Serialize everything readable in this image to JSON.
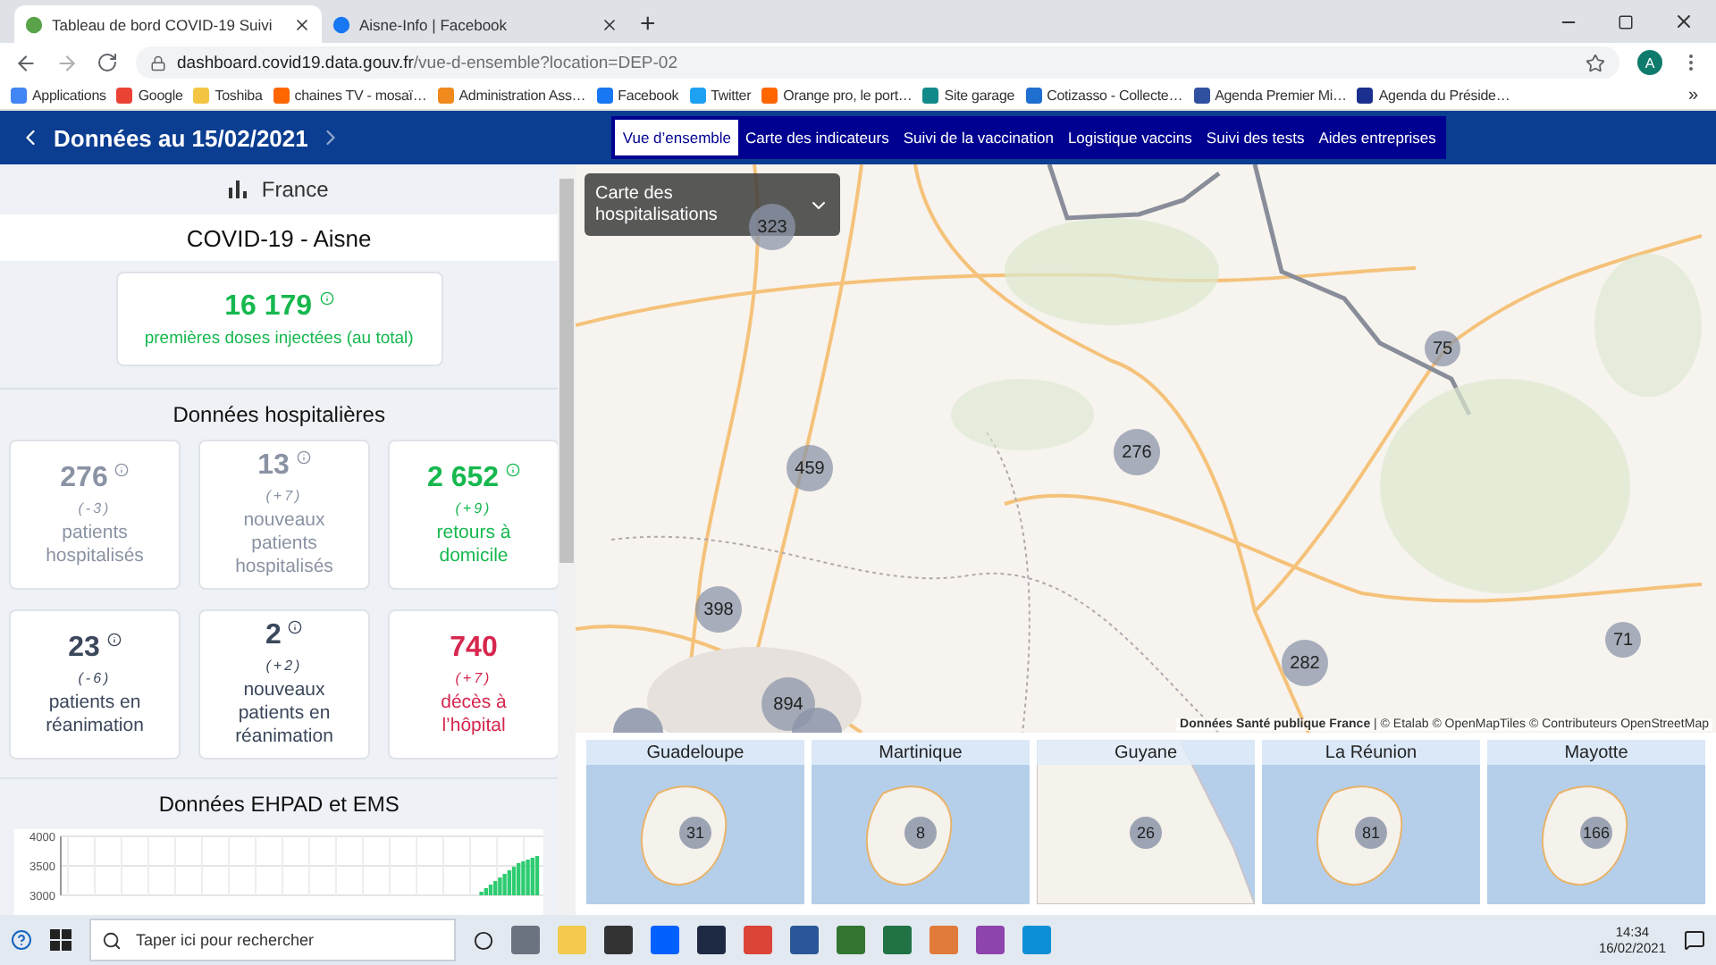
{
  "browser": {
    "tabs": [
      {
        "title": "Tableau de bord COVID-19 Suivi",
        "selected": true
      },
      {
        "title": "Aisne-Info | Facebook",
        "selected": false
      }
    ],
    "new_tab": "+",
    "url": {
      "host": "dashboard.covid19.data.gouv.fr",
      "path": "/vue-d-ensemble?location=DEP-02"
    },
    "profile": "A",
    "bookmarks": [
      {
        "label": "Applications",
        "color": "#4285f4"
      },
      {
        "label": "Google",
        "color": "#ea4335"
      },
      {
        "label": "Toshiba",
        "color": "#f4c542"
      },
      {
        "label": "chaines TV - mosaï…",
        "color": "#ff6600"
      },
      {
        "label": "Administration Ass…",
        "color": "#f08a1c"
      },
      {
        "label": "Facebook",
        "color": "#1877f2"
      },
      {
        "label": "Twitter",
        "color": "#1da1f2"
      },
      {
        "label": "Orange pro, le port…",
        "color": "#ff6600"
      },
      {
        "label": "Site garage",
        "color": "#138a8a"
      },
      {
        "label": "Cotizasso - Collecte…",
        "color": "#1f6fd0"
      },
      {
        "label": "Agenda Premier Mi…",
        "color": "#3050a0"
      },
      {
        "label": "Agenda du Préside…",
        "color": "#1b2f8f"
      }
    ],
    "bookmarks_more": "»"
  },
  "header": {
    "title": "Données au 15/02/2021",
    "nav": [
      {
        "label": "Vue d’ensemble",
        "selected": true
      },
      {
        "label": "Carte des indicateurs",
        "selected": false
      },
      {
        "label": "Suivi de la vaccination",
        "selected": false
      },
      {
        "label": "Logistique vaccins",
        "selected": false
      },
      {
        "label": "Suivi des tests",
        "selected": false
      },
      {
        "label": "Aides entreprises",
        "selected": false
      }
    ]
  },
  "sidebar": {
    "scope": "France",
    "region_title": "COVID-19 - Aisne",
    "vaccination": {
      "value": "16 179",
      "label": "premières doses injectées (au total)"
    },
    "hospital_title": "Données hospitalières",
    "cards": [
      {
        "value": "276",
        "delta": "(-3)",
        "label": "patients hospitalisés",
        "kind": "muted",
        "info": true
      },
      {
        "value": "13",
        "delta": "(+7)",
        "label": "nouveaux patients hospitalisés",
        "kind": "muted",
        "info": true
      },
      {
        "value": "2 652",
        "delta": "(+9)",
        "label": "retours à domicile",
        "kind": "positive",
        "info": true
      },
      {
        "value": "23",
        "delta": "(-6)",
        "label": "patients en réanimation",
        "kind": "dark",
        "info": true
      },
      {
        "value": "2",
        "delta": "(+2)",
        "label": "nouveaux patients en réanimation",
        "kind": "dark",
        "info": true
      },
      {
        "value": "740",
        "delta": "(+7)",
        "label": "décès à l’hôpital",
        "kind": "negative",
        "info": false
      }
    ],
    "ehpad_title": "Données EHPAD et EMS",
    "chart_axis_labels": [
      "4000",
      "3500",
      "3000"
    ]
  },
  "map": {
    "layer": "Carte des hospitalisations",
    "clusters": [
      "323",
      "459",
      "276",
      "75",
      "398",
      "894",
      "282",
      "71"
    ],
    "attribution": "**Données Santé publique France** | © Etalab © OpenMapTiles © Contributeurs OpenStreetMap"
  },
  "overseas": [
    {
      "name": "Guadeloupe",
      "count": "31",
      "kind": "island"
    },
    {
      "name": "Martinique",
      "count": "8",
      "kind": "island"
    },
    {
      "name": "Guyane",
      "count": "26",
      "kind": "coast"
    },
    {
      "name": "La Réunion",
      "count": "81",
      "kind": "island"
    },
    {
      "name": "Mayotte",
      "count": "166",
      "kind": "island"
    }
  ],
  "taskbar": {
    "search_placeholder": "Taper ici pour rechercher",
    "time": "14:34",
    "date": "16/02/2021"
  }
}
